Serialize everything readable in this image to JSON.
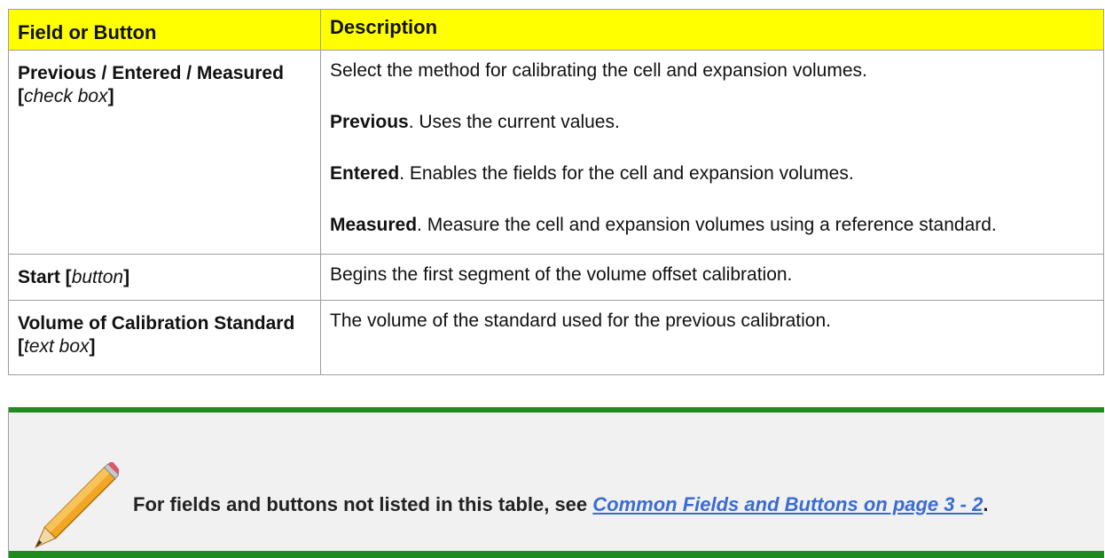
{
  "table": {
    "header": {
      "col1": "Field or Button",
      "col2": "Description"
    },
    "rows": [
      {
        "field_bold": "Previous / Entered / Measured",
        "field_bracket_open": "[",
        "field_italic": "check box",
        "field_bracket_close": "]",
        "desc": [
          {
            "bold": "",
            "text": "Select the method for calibrating the cell and expansion volumes."
          },
          {
            "bold": "Previous",
            "text": ". Uses the current values."
          },
          {
            "bold": "Entered",
            "text": ". Enables the fields for the cell and expansion volumes."
          },
          {
            "bold": "Measured",
            "text": ". Measure the cell and expansion volumes using a reference standard."
          }
        ]
      },
      {
        "field_bold": "Start [",
        "field_italic": "button",
        "field_bracket_close": "]",
        "desc_text": "Begins the first segment of the volume offset calibration."
      },
      {
        "field_bold": "Volume of Calibration Standard [",
        "field_italic": "text box",
        "field_bracket_close": "]",
        "desc_text": "The volume of the standard used for the previous calibration."
      }
    ]
  },
  "note": {
    "icon": "pencil-icon",
    "text_prefix": "For fields and buttons not listed in this table, see ",
    "link_text": "Common Fields and Buttons on page 3 - 2",
    "text_suffix": ".",
    "accent_color": "#1f8a1f"
  },
  "colors": {
    "header_bg": "#ffff00",
    "link": "#3b6cd1",
    "note_bg": "#f1f1f1"
  }
}
